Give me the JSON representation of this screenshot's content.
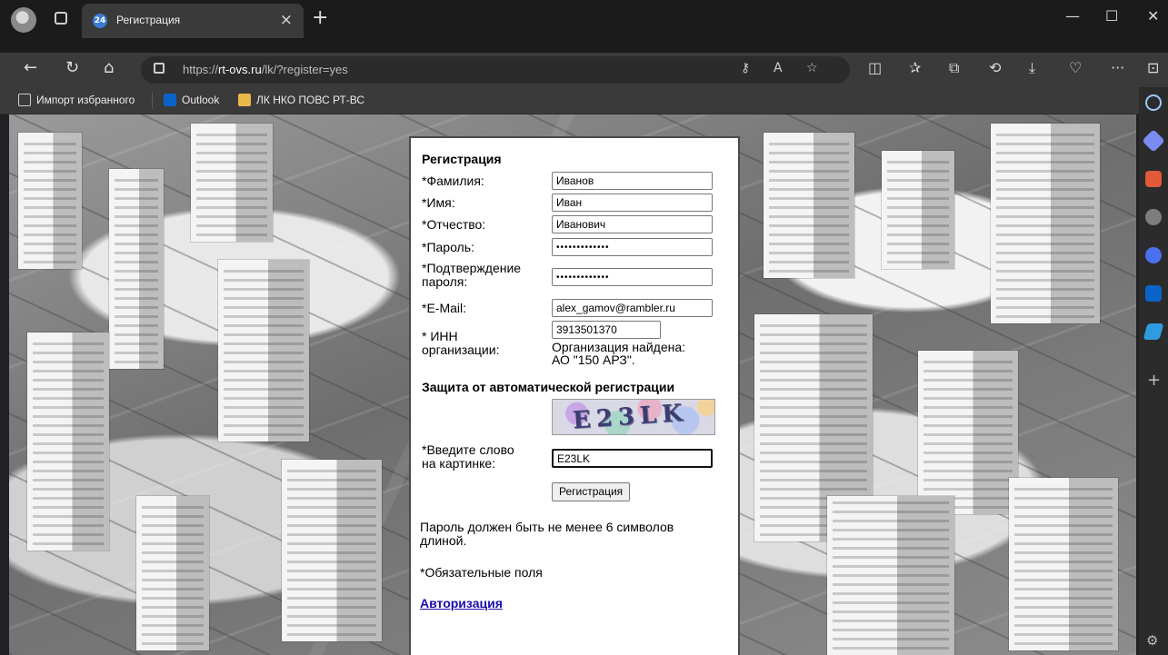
{
  "browser": {
    "tab": {
      "badge": "24",
      "title": "Регистрация",
      "close": "×"
    },
    "new_tab": "+",
    "window_controls": {
      "minimize": "—",
      "maximize": "☐",
      "close": "✕"
    },
    "nav": {
      "back": "←",
      "reload": "↻",
      "home": "⌂"
    },
    "address": {
      "protocol": "https://",
      "host": "rt-ovs.ru",
      "path": "/lk/?register=yes"
    },
    "favorites": [
      {
        "label": "Импорт избранного",
        "icon": "import-icon"
      },
      {
        "label": "Outlook",
        "icon": "outlook-icon"
      },
      {
        "label": "ЛК НКО ПОВС РТ-ВС",
        "icon": "folder-icon"
      }
    ],
    "toolbar_more": "···"
  },
  "form": {
    "title": "Регистрация",
    "labels": {
      "last_name": "*Фамилия:",
      "first_name": "*Имя:",
      "middle_name": "*Отчество:",
      "password": "*Пароль:",
      "confirm_line1": "*Подтверждение",
      "confirm_line2": "пароля:",
      "email": "*E-Mail:",
      "inn_line1": "* ИНН",
      "inn_line2": "организации:",
      "captcha_line1": "*Введите слово",
      "captcha_line2": "на картинке:"
    },
    "values": {
      "last_name": "Иванов",
      "first_name": "Иван",
      "middle_name": "Иванович",
      "password": "•••••••••••••",
      "confirm": "•••••••••••••",
      "email": "alex_gamov@rambler.ru",
      "inn": "3913501370",
      "captcha": "E23LK"
    },
    "org_found_line1": "Организация найдена:",
    "org_found_line2": "АО \"150 АРЗ\".",
    "captcha_section": "Защита от автоматической регистрации",
    "captcha_image_text": "E23LK",
    "submit": "Регистрация",
    "password_note_line1": "Пароль должен быть не менее 6 символов",
    "password_note_line2": "длиной.",
    "required_note": "*Обязательные поля",
    "auth_link": "Авторизация"
  }
}
